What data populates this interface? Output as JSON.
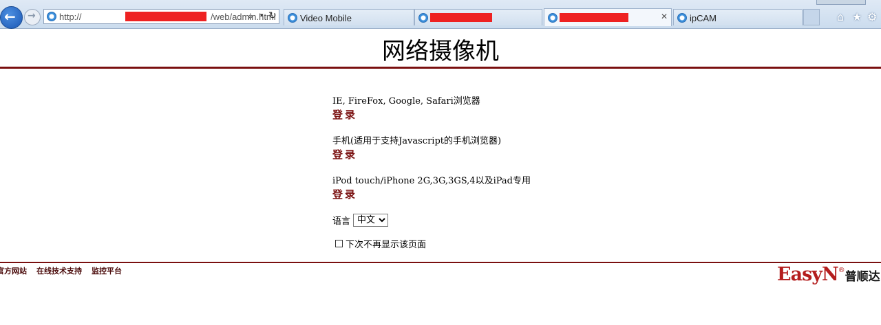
{
  "browser": {
    "address_prefix": "http://",
    "address_path": "/web/admin.html",
    "tabs": [
      {
        "label": "Video Mobile",
        "redacted": false
      },
      {
        "label": "",
        "redacted": true
      },
      {
        "label": "",
        "redacted": true,
        "active": true
      },
      {
        "label": "ipCAM",
        "redacted": false
      }
    ],
    "icons": [
      "back-icon",
      "forward-icon",
      "search-icon",
      "refresh-icon",
      "home-icon",
      "favorites-star-icon",
      "tools-gear-icon"
    ],
    "accent_color": "#ee2222"
  },
  "page": {
    "title": "网络摄像机",
    "sections": [
      {
        "description": "IE, FireFox, Google, Safari浏览器",
        "login_label": "登录"
      },
      {
        "description": "手机(适用于支持Javascript的手机浏览器)",
        "login_label": "登录"
      },
      {
        "description": "iPod touch/iPhone 2G,3G,3GS,4以及iPad专用",
        "login_label": "登录"
      }
    ],
    "language_label": "语言",
    "language_selected": "中文",
    "skip_label": "下次不再显示该页面",
    "theme_color": "#7a0f0f"
  },
  "footer": {
    "links": [
      "官方网站",
      "在线技术支持",
      "监控平台"
    ],
    "brand_en": "EasyN",
    "brand_reg": "®",
    "brand_cn": "普顺达"
  }
}
